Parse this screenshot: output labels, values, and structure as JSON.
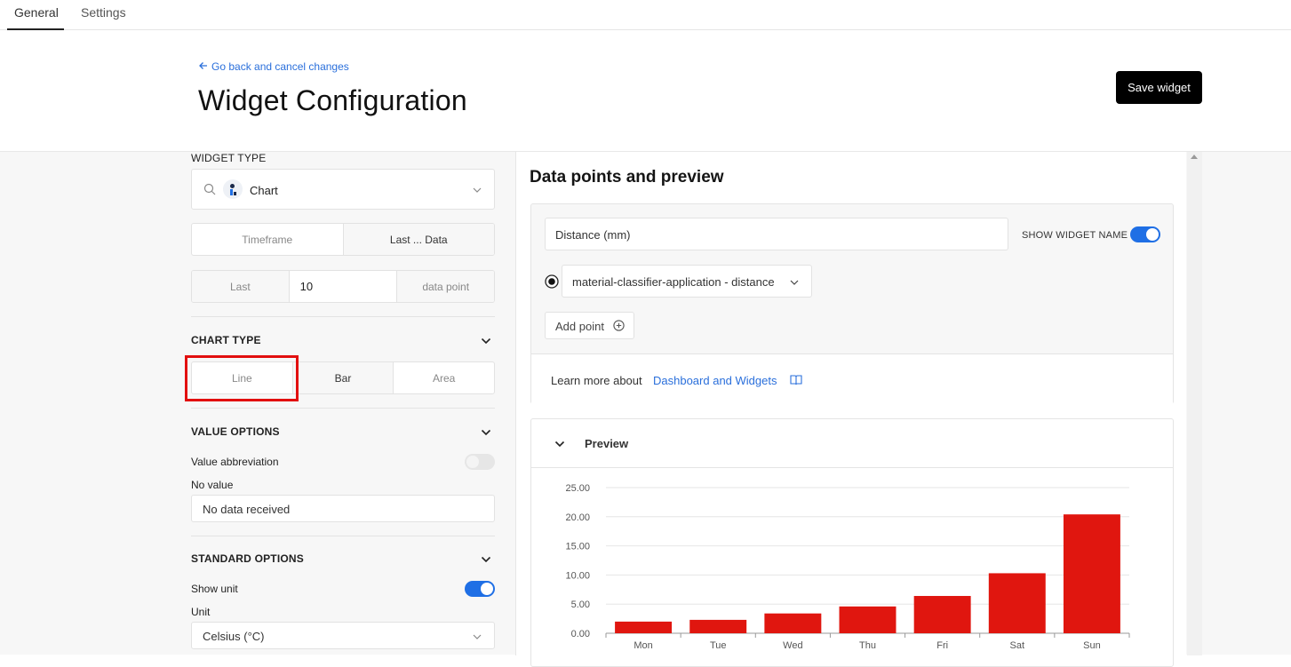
{
  "tabs": {
    "general": "General",
    "settings": "Settings"
  },
  "header": {
    "back_link": "Go back and cancel changes",
    "title": "Widget Configuration",
    "save_label": "Save widget"
  },
  "left": {
    "widget_type_label": "WIDGET TYPE",
    "widget_type_value": "Chart",
    "timeframe_segment": [
      "Timeframe",
      "Last ... Data"
    ],
    "last_row": {
      "prefix": "Last",
      "value": "10",
      "suffix": "data point"
    },
    "chart_type_label": "CHART TYPE",
    "chart_types": [
      "Line",
      "Bar",
      "Area"
    ],
    "value_options_label": "VALUE OPTIONS",
    "value_abbreviation_label": "Value abbreviation",
    "value_abbreviation_on": false,
    "no_value_label": "No value",
    "no_value_value": "No data received",
    "standard_options_label": "STANDARD OPTIONS",
    "show_unit_label": "Show unit",
    "show_unit_on": true,
    "unit_label": "Unit",
    "unit_value": "Celsius (°C)"
  },
  "right": {
    "title": "Data points and preview",
    "name_input_value": "Distance (mm)",
    "show_widget_name_label": "SHOW WIDGET NAME",
    "show_widget_name_on": true,
    "data_point_select": "material-classifier-application - distance",
    "add_point_label": "Add point",
    "learn_more_prefix": "Learn more about",
    "learn_more_link": "Dashboard and Widgets",
    "preview_label": "Preview"
  },
  "colors": {
    "accent": "#1f6fe5",
    "bar": "#e0160f",
    "highlight": "#e20f0f",
    "link": "#2a6fdb"
  },
  "chart_data": {
    "type": "bar",
    "categories": [
      "Mon",
      "Tue",
      "Wed",
      "Thu",
      "Fri",
      "Sat",
      "Sun"
    ],
    "values": [
      2.0,
      2.3,
      3.4,
      4.6,
      6.4,
      10.3,
      20.4
    ],
    "yticks": [
      "0.00",
      "5.00",
      "10.00",
      "15.00",
      "20.00",
      "25.00"
    ],
    "ylim": [
      0,
      25
    ],
    "grid": true
  }
}
